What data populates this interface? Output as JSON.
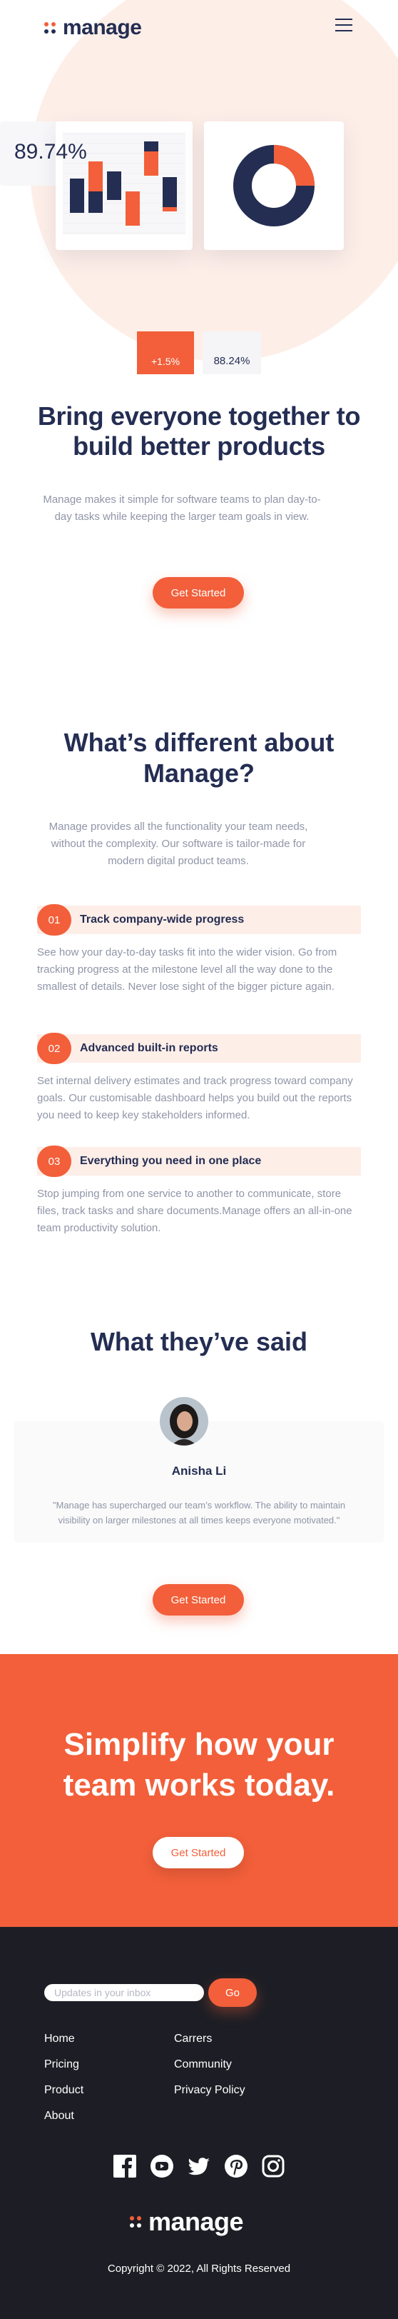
{
  "header": {
    "logo_text": "manage",
    "menu_icon": "hamburger-menu-icon"
  },
  "hero": {
    "stat_value": "89.74%",
    "stat_change": "+1.5%",
    "stat_secondary": "88.24%",
    "title": "Bring everyone together to build better products",
    "description": "Manage makes it simple for software teams to plan day-to-day tasks while keeping the larger team goals in view.",
    "cta_label": "Get Started"
  },
  "features_section": {
    "title": "What’s different about Manage?",
    "description": "Manage provides all the functionality your team needs, without the complexity. Our software is tailor-made for modern digital product teams.",
    "items": [
      {
        "number": "01",
        "title": "Track company-wide progress",
        "description": "See how your day-to-day tasks fit into the wider vision. Go from tracking progress at the milestone level all the way done to the smallest of details. Never lose sight of the bigger picture again."
      },
      {
        "number": "02",
        "title": "Advanced built-in reports",
        "description": "Set internal delivery estimates and track progress toward company goals. Our customisable dashboard helps you build out the reports you need to keep key stakeholders informed."
      },
      {
        "number": "03",
        "title": "Everything you need in one place",
        "description": "Stop jumping from one service to another to communicate, store files, track tasks and share documents.Manage offers an all-in-one team productivity solution."
      }
    ]
  },
  "testimonials": {
    "title": "What they’ve said",
    "items": [
      {
        "name": "Anisha Li",
        "quote": "\"Manage has supercharged our team’s workflow. The ability to maintain visibility on larger milestones at all times keeps everyone motivated.\""
      }
    ],
    "cta_label": "Get Started"
  },
  "cta_band": {
    "title": "Simplify how your team works today.",
    "cta_label": "Get Started"
  },
  "footer": {
    "newsletter_placeholder": "Updates in your inbox",
    "go_label": "Go",
    "links_col1": [
      "Home",
      "Pricing",
      "Product",
      "About"
    ],
    "links_col2": [
      "Carrers",
      "Community",
      "Privacy Policy"
    ],
    "socials": [
      "facebook-icon",
      "youtube-icon",
      "twitter-icon",
      "pinterest-icon",
      "instagram-icon"
    ],
    "logo_text": "manage",
    "copyright": "Copyright © 2022, All Rights Reserved"
  },
  "colors": {
    "accent": "#f25f3a",
    "navy": "#242d52",
    "muted_text": "#9095a7",
    "pale_accent": "#fdeee8",
    "footer_bg": "#1d1e25"
  }
}
